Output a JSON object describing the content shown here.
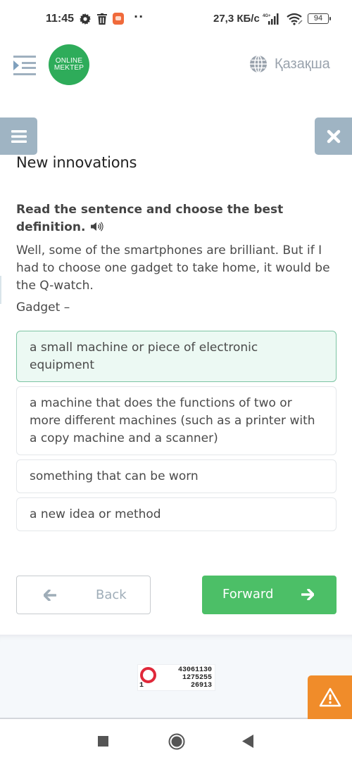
{
  "status_bar": {
    "time": "11:45",
    "icons": [
      "gear-icon",
      "trash-icon",
      "app-notification-icon",
      "more-dots-icon"
    ],
    "dots": "··",
    "network_speed": "27,3 КБ/с",
    "signal_label": "4G+",
    "battery": "94"
  },
  "header": {
    "menu_icon": "indent-menu-icon",
    "logo_line1": "ONLINE",
    "logo_line2": "MEKTEP",
    "language": "Қазақша"
  },
  "lesson": {
    "title": "New innovations",
    "instruction": "Read the sentence and choose the best definition.",
    "passage": "Well, some of the smartphones are brilliant. But if I had to choose one gadget to take home, it would be the Q-watch.",
    "term": "Gadget –",
    "options": [
      {
        "text": "a small machine or piece of electronic equipment",
        "selected": true
      },
      {
        "text": "a machine that does the functions of two or more different machines (such as a printer with a copy machine and a scanner)",
        "selected": false
      },
      {
        "text": "something that can be worn",
        "selected": false
      },
      {
        "text": "a new idea or method",
        "selected": false
      }
    ]
  },
  "navigation": {
    "back_label": "Back",
    "forward_label": "Forward"
  },
  "footer": {
    "counter": {
      "line1": "43061130",
      "line2": "1275255",
      "line3": "26913",
      "rank": "1"
    }
  },
  "colors": {
    "brand_green": "#2eac5a",
    "forward_green": "#4cbf67",
    "selected_bg": "#ecf9f3",
    "side_button": "#9fb4c3",
    "alert_orange": "#f08c2a"
  }
}
